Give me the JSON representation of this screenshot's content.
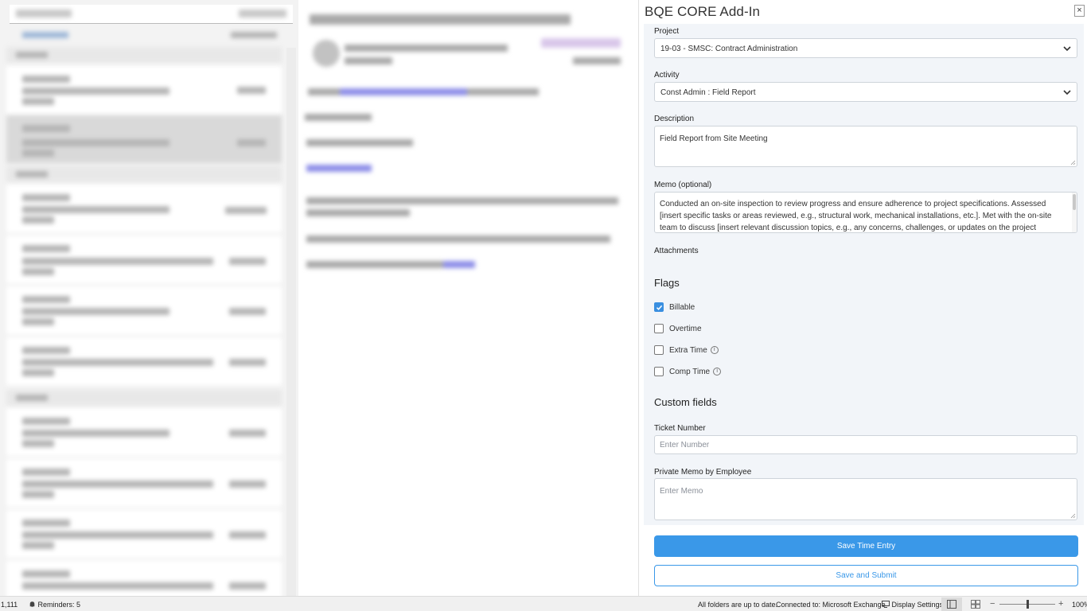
{
  "addin": {
    "title": "BQE CORE Add-In",
    "close_glyph": "×",
    "project": {
      "label": "Project",
      "value": "19-03 - SMSC: Contract Administration"
    },
    "activity": {
      "label": "Activity",
      "value": "Const Admin : Field Report"
    },
    "description": {
      "label": "Description",
      "value": "Field Report from Site Meeting"
    },
    "memo": {
      "label": "Memo (optional)",
      "value": "Conducted an on-site inspection to review progress and ensure adherence to project specifications. Assessed [insert specific tasks or areas reviewed, e.g., structural work, mechanical installations, etc.]. Met with the on-site team to discuss [insert relevant discussion topics, e.g., any concerns, challenges, or updates on the project timeline]. Identified [insert any issues found or recommendations]."
    },
    "attachments_label": "Attachments",
    "flags": {
      "heading": "Flags",
      "items": [
        {
          "label": "Billable",
          "checked": true,
          "info": false
        },
        {
          "label": "Overtime",
          "checked": false,
          "info": false
        },
        {
          "label": "Extra Time",
          "checked": false,
          "info": true
        },
        {
          "label": "Comp Time",
          "checked": false,
          "info": true
        }
      ]
    },
    "custom_fields": {
      "heading": "Custom fields",
      "ticket": {
        "label": "Ticket Number",
        "placeholder": "Enter Number"
      },
      "private_memo": {
        "label": "Private Memo by Employee",
        "placeholder": "Enter Memo"
      }
    },
    "buttons": {
      "save": "Save Time Entry",
      "submit": "Save and Submit"
    }
  },
  "status_bar": {
    "count": "1,111",
    "reminders": "Reminders: 5",
    "sync": "All folders are up to date.",
    "connection": "Connected to: Microsoft Exchange",
    "display_settings": "Display Settings",
    "zoom": "100%",
    "zoom_minus": "−",
    "zoom_plus": "+"
  },
  "colors": {
    "primary": "#3a98e8",
    "form_bg": "#f2f5f9",
    "checked": "#3a8fe0"
  }
}
